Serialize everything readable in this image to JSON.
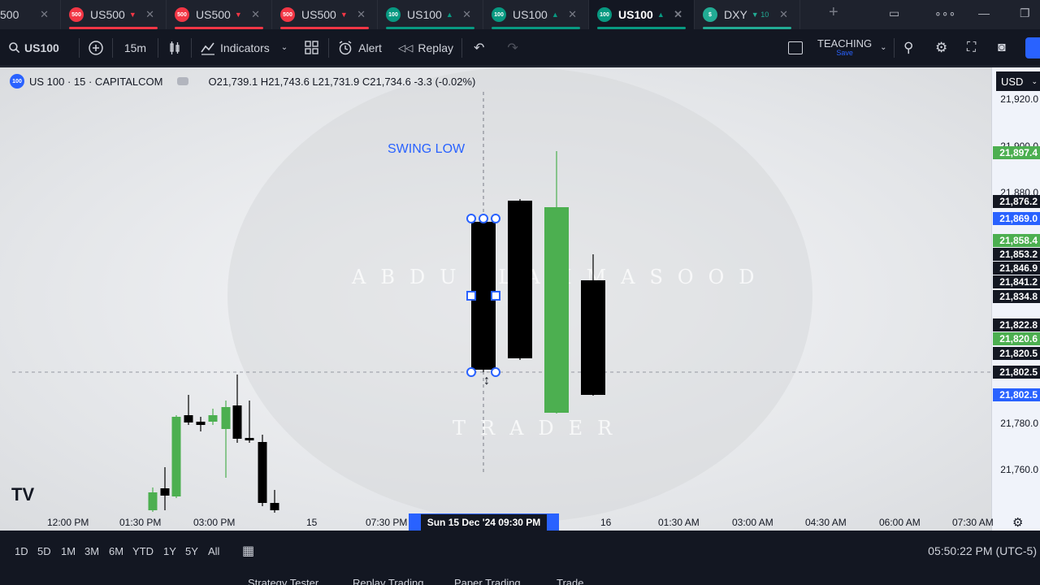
{
  "tabs": [
    {
      "label": "500",
      "icon": "",
      "color": "#f23645",
      "active": false
    },
    {
      "label": "US500",
      "icon": "500",
      "color": "#f23645",
      "dir": "▼",
      "active": false
    },
    {
      "label": "US500",
      "icon": "500",
      "color": "#f23645",
      "dir": "▼",
      "active": false
    },
    {
      "label": "US500",
      "icon": "500",
      "color": "#f23645",
      "dir": "▼",
      "active": false
    },
    {
      "label": "US100",
      "icon": "100",
      "color": "#089981",
      "dir": "▲",
      "active": false
    },
    {
      "label": "US100",
      "icon": "100",
      "color": "#089981",
      "dir": "▲",
      "active": false
    },
    {
      "label": "US100",
      "icon": "100",
      "color": "#089981",
      "dir": "▲",
      "active": true
    },
    {
      "label": "DXY",
      "icon": "$",
      "color": "#22ab94",
      "dir": "▼ 10",
      "active": false
    }
  ],
  "toolbar": {
    "symbol": "US100",
    "interval": "15m",
    "indicators": "Indicators",
    "alert": "Alert",
    "replay": "Replay",
    "layout_name": "TEACHING",
    "layout_status": "Save"
  },
  "legend": {
    "symbol_icon": "100",
    "title": "US 100 · 15 · CAPITALCOM",
    "ohlc": "O21,739.1 H21,743.6 L21,731.9 C21,734.6 -3.3 (-0.02%)"
  },
  "annotation": {
    "text": "SWING LOW"
  },
  "watermark": {
    "line1": "ABDULLAHMASOOD",
    "line2": "TRADER"
  },
  "logo": "TV",
  "price_scale": {
    "currency": "USD",
    "labels": [
      "21,920.0",
      "21,900.0",
      "21,880.0",
      "21,780.0",
      "21,760.0"
    ],
    "badges": [
      {
        "value": "21,897.4",
        "color": "#4caf50"
      },
      {
        "value": "21,876.2",
        "color": "#131722"
      },
      {
        "value": "21,869.0",
        "color": "#2962ff"
      },
      {
        "value": "21,858.4",
        "color": "#4caf50"
      },
      {
        "value": "21,853.2",
        "color": "#131722"
      },
      {
        "value": "21,846.9",
        "color": "#131722"
      },
      {
        "value": "21,841.2",
        "color": "#131722"
      },
      {
        "value": "21,834.8",
        "color": "#131722"
      },
      {
        "value": "21,822.8",
        "color": "#131722"
      },
      {
        "value": "21,820.6",
        "color": "#4caf50"
      },
      {
        "value": "21,820.5",
        "color": "#131722"
      },
      {
        "value": "21,802.5",
        "color": "#131722"
      },
      {
        "value": "21,802.5",
        "color": "#2962ff"
      }
    ]
  },
  "time_scale": {
    "labels": [
      "12:00 PM",
      "01:30 PM",
      "03:00 PM",
      "15",
      "07:30 PM",
      "16",
      "01:30 AM",
      "03:00 AM",
      "04:30 AM",
      "06:00 AM",
      "07:30 AM"
    ],
    "crosshair_label": "Sun 15 Dec '24   09:30 PM"
  },
  "bottom": {
    "ranges": [
      "1D",
      "5D",
      "1M",
      "3M",
      "6M",
      "YTD",
      "1Y",
      "5Y",
      "All"
    ],
    "clock": "05:50:22 PM (UTC-5)"
  },
  "panel_tabs": [
    "Strategy Tester",
    "Replay Trading",
    "Paper Trading",
    "Trade"
  ],
  "candles": {
    "up_color": "#4caf50",
    "down_color": "#000000"
  }
}
